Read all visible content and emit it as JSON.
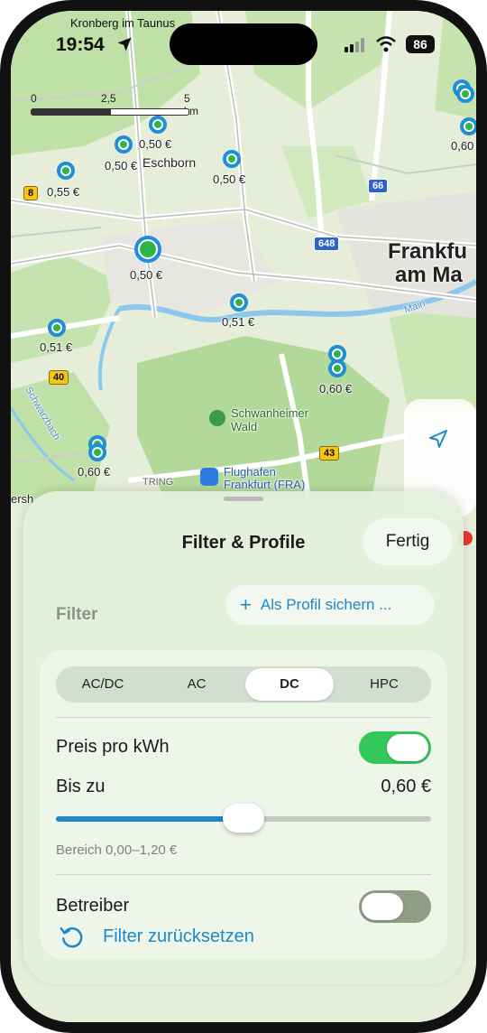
{
  "status": {
    "time": "19:54",
    "battery": "86",
    "top_place": "Kronberg im Taunus"
  },
  "scale": {
    "ticks": [
      "0",
      "2,5",
      "5 km"
    ]
  },
  "map": {
    "labels": {
      "eschborn": "Eschborn",
      "city": [
        "Frankfu",
        "am Ma"
      ],
      "schwanheimer": [
        "Schwanheimer",
        "Wald"
      ],
      "flughafen": [
        "Flughafen",
        "Frankfurt (FRA)"
      ],
      "main": "Main",
      "schwarzbach": "Schwarzbach",
      "tring": "TRING",
      "hersh": "ersh"
    },
    "roads": {
      "r8": "8",
      "r66": "66",
      "r648": "648",
      "r40": "40",
      "r43": "43"
    },
    "prices": [
      "0,50 €",
      "0,50 €",
      "0,55 €",
      "0,50 €",
      "0,50 €",
      "0,51 €",
      "0,51 €",
      "0,60 €",
      "0,60 €",
      "0,60"
    ]
  },
  "sheet": {
    "title": "Filter & Profile",
    "done_label": "Fertig",
    "filter_label": "Filter",
    "save_profile_label": "Als Profil sichern ...",
    "segments": [
      "AC/DC",
      "AC",
      "DC",
      "HPC"
    ],
    "selected_segment": "DC",
    "price_label": "Preis pro kWh",
    "price_toggle_on": true,
    "upto_label": "Bis zu",
    "upto_value": "0,60 €",
    "slider_fraction": 0.5,
    "range_note": "Bereich 0,00–1,20 €",
    "operator_label": "Betreiber",
    "operator_toggle_on": false,
    "reset_label": "Filter zurücksetzen"
  },
  "colors": {
    "accent": "#1e88c9",
    "toggle_on": "#34c759",
    "pin_ring": "#1f8fd6",
    "pin_fill": "#2fb44b"
  }
}
